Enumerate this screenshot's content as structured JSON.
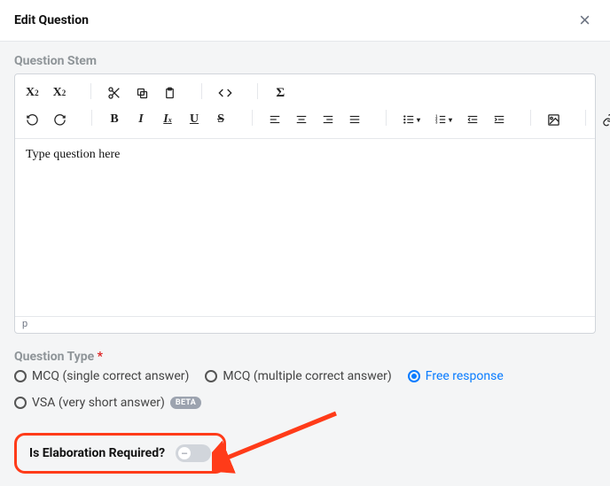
{
  "modal": {
    "title": "Edit Question"
  },
  "stem": {
    "label": "Question Stem",
    "placeholder": "Type question here",
    "status_path": "p"
  },
  "toolbar": {
    "row1": {
      "subscript": "X₂",
      "superscript": "X²",
      "cut": "cut-icon",
      "copy": "copy-icon",
      "paste": "paste-icon",
      "code": "code-icon",
      "sum": "Σ"
    }
  },
  "questionType": {
    "label": "Question Type",
    "required": "*",
    "options": [
      {
        "id": "mcq-single",
        "label": "MCQ (single correct answer)",
        "selected": false
      },
      {
        "id": "mcq-multi",
        "label": "MCQ (multiple correct answer)",
        "selected": false
      },
      {
        "id": "free",
        "label": "Free response",
        "selected": true
      },
      {
        "id": "vsa",
        "label": "VSA (very short answer)",
        "selected": false,
        "badge": "BETA"
      }
    ]
  },
  "elaboration": {
    "label": "Is Elaboration Required?",
    "on": false
  }
}
